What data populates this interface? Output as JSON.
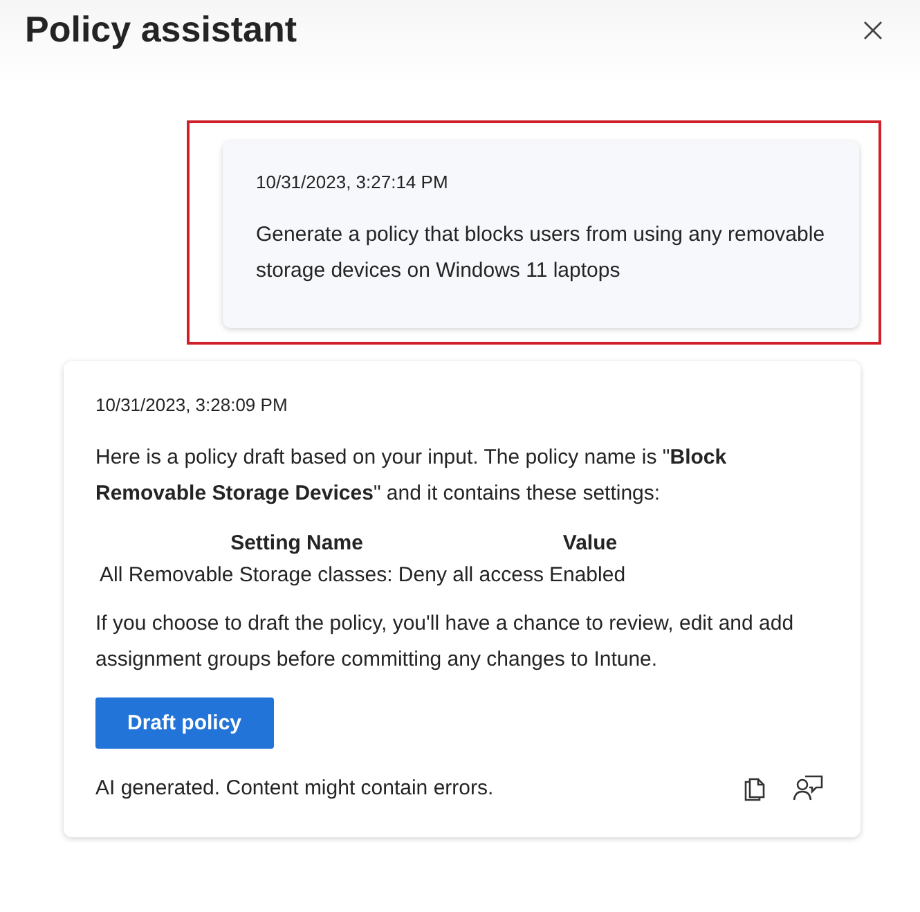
{
  "window": {
    "title": "Policy assistant"
  },
  "messages": [
    {
      "kind": "user",
      "highlighted": true,
      "time": "10/31/2023, 3:27:14 PM",
      "text": "Generate a policy that blocks users from using any removable storage devices on Windows 11 laptops"
    },
    {
      "kind": "assistant",
      "highlighted": false,
      "time": "10/31/2023, 3:28:09 PM",
      "intro": "Here is a policy draft based on your input. The policy name is \"**Block Removable Storage Devices**\" and it contains these settings:",
      "table": {
        "columns": [
          "Setting Name",
          "Value"
        ],
        "rows": [
          [
            "All Removable Storage classes: Deny all access",
            "Enabled"
          ]
        ]
      },
      "outro": "If you choose to draft the policy, you'll have a chance to review, edit and add assignment groups before committing any changes to Intune.",
      "button": "Draft policy",
      "disclaimer": "AI generated. Content might contain errors."
    }
  ]
}
